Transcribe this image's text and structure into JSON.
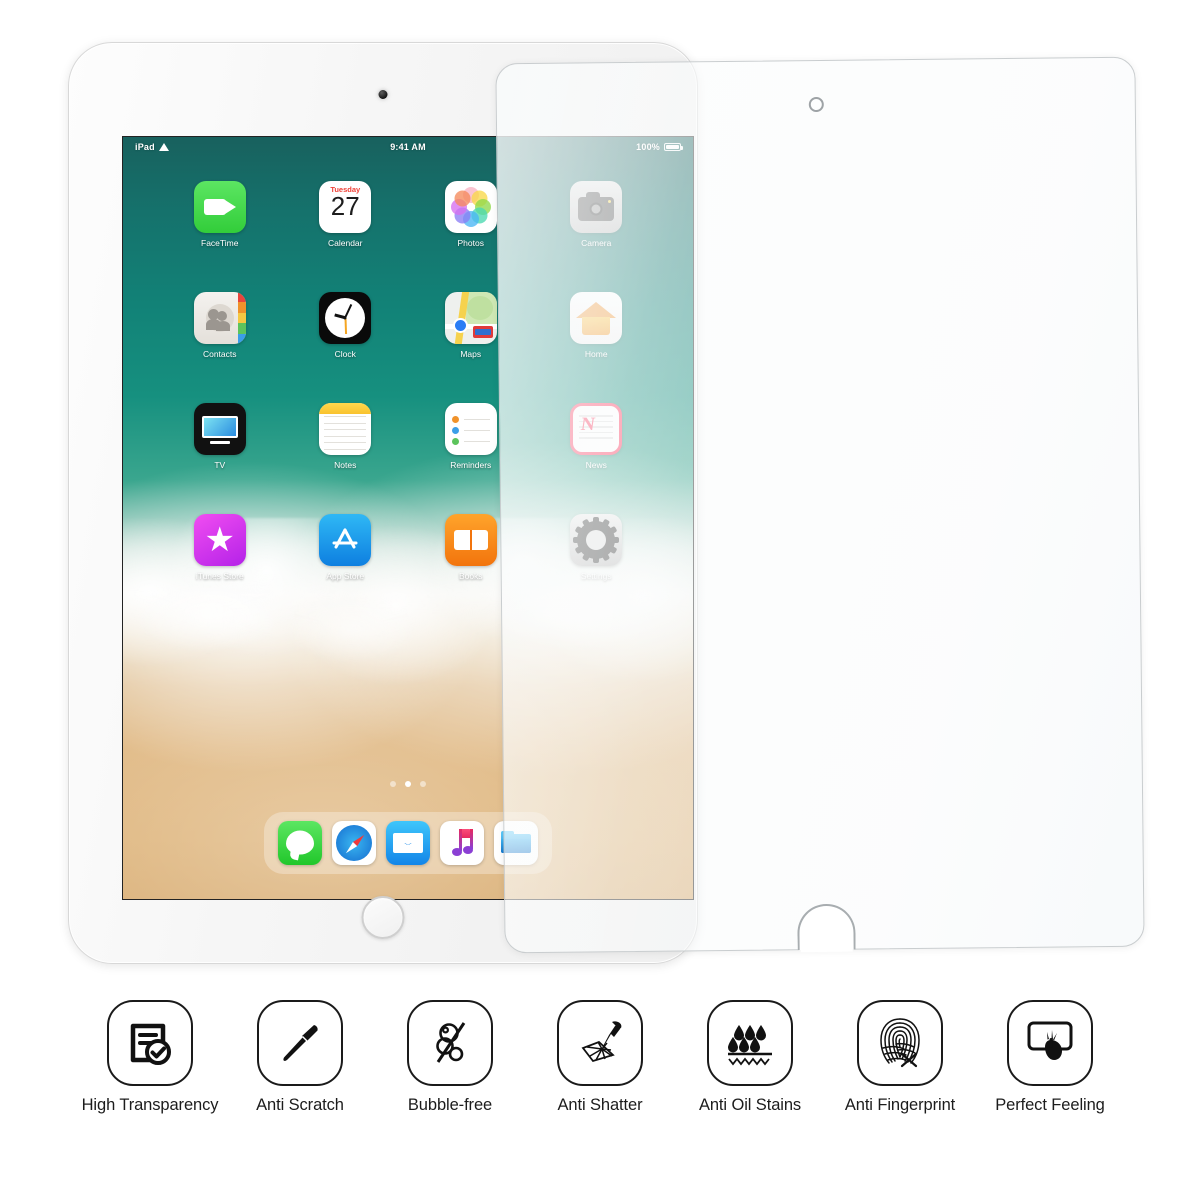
{
  "product": {
    "device_name": "iPad",
    "screen_protector": "tempered-glass-screen-protector",
    "protector_camera_cutout": "camera-cutout",
    "protector_home_cutout": "home-button-cutout"
  },
  "status_bar": {
    "carrier": "iPad",
    "wifi_icon": "wifi-icon",
    "time": "9:41 AM",
    "battery_percent": "100%",
    "battery_icon": "battery-full-icon"
  },
  "home_screen": {
    "apps": [
      {
        "label": "FaceTime",
        "icon": "facetime-icon"
      },
      {
        "label": "Calendar",
        "icon": "calendar-icon",
        "weekday": "Tuesday",
        "day": "27"
      },
      {
        "label": "Photos",
        "icon": "photos-icon"
      },
      {
        "label": "Camera",
        "icon": "camera-icon"
      },
      {
        "label": "Contacts",
        "icon": "contacts-icon"
      },
      {
        "label": "Clock",
        "icon": "clock-icon"
      },
      {
        "label": "Maps",
        "icon": "maps-icon"
      },
      {
        "label": "Home",
        "icon": "home-icon"
      },
      {
        "label": "TV",
        "icon": "tv-icon"
      },
      {
        "label": "Notes",
        "icon": "notes-icon"
      },
      {
        "label": "Reminders",
        "icon": "reminders-icon"
      },
      {
        "label": "News",
        "icon": "news-icon"
      },
      {
        "label": "iTunes Store",
        "icon": "itunes-store-icon"
      },
      {
        "label": "App Store",
        "icon": "app-store-icon"
      },
      {
        "label": "Books",
        "icon": "books-icon"
      },
      {
        "label": "Settings",
        "icon": "settings-icon"
      }
    ],
    "page_dots": {
      "count": 3,
      "active_index": 1
    },
    "dock": [
      {
        "label": "Messages",
        "icon": "messages-icon"
      },
      {
        "label": "Safari",
        "icon": "safari-icon"
      },
      {
        "label": "Mail",
        "icon": "mail-icon"
      },
      {
        "label": "Music",
        "icon": "music-icon"
      },
      {
        "label": "Files",
        "icon": "files-icon"
      }
    ],
    "wallpaper": "beach-ocean-wallpaper"
  },
  "features": [
    {
      "label": "High Transparency",
      "icon": "document-check-icon"
    },
    {
      "label": "Anti Scratch",
      "icon": "knife-icon"
    },
    {
      "label": "Bubble-free",
      "icon": "no-bubbles-icon"
    },
    {
      "label": "Anti Shatter",
      "icon": "hammer-shatter-icon"
    },
    {
      "label": "Anti Oil Stains",
      "icon": "oil-droplets-icon"
    },
    {
      "label": "Anti Fingerprint",
      "icon": "fingerprint-icon"
    },
    {
      "label": "Perfect Feeling",
      "icon": "touch-screen-icon"
    }
  ],
  "colors": {
    "background": "#ffffff",
    "icon_stroke": "#1a1a1a",
    "label_text": "#1c1c1c",
    "device_body": "#f6f6f6",
    "wallpaper_top": "#15726c",
    "wallpaper_bottom": "#ddb277",
    "news_accent": "#fc3158",
    "facetime_green": "#32cd3a",
    "appstore_blue": "#0e7fe0"
  }
}
